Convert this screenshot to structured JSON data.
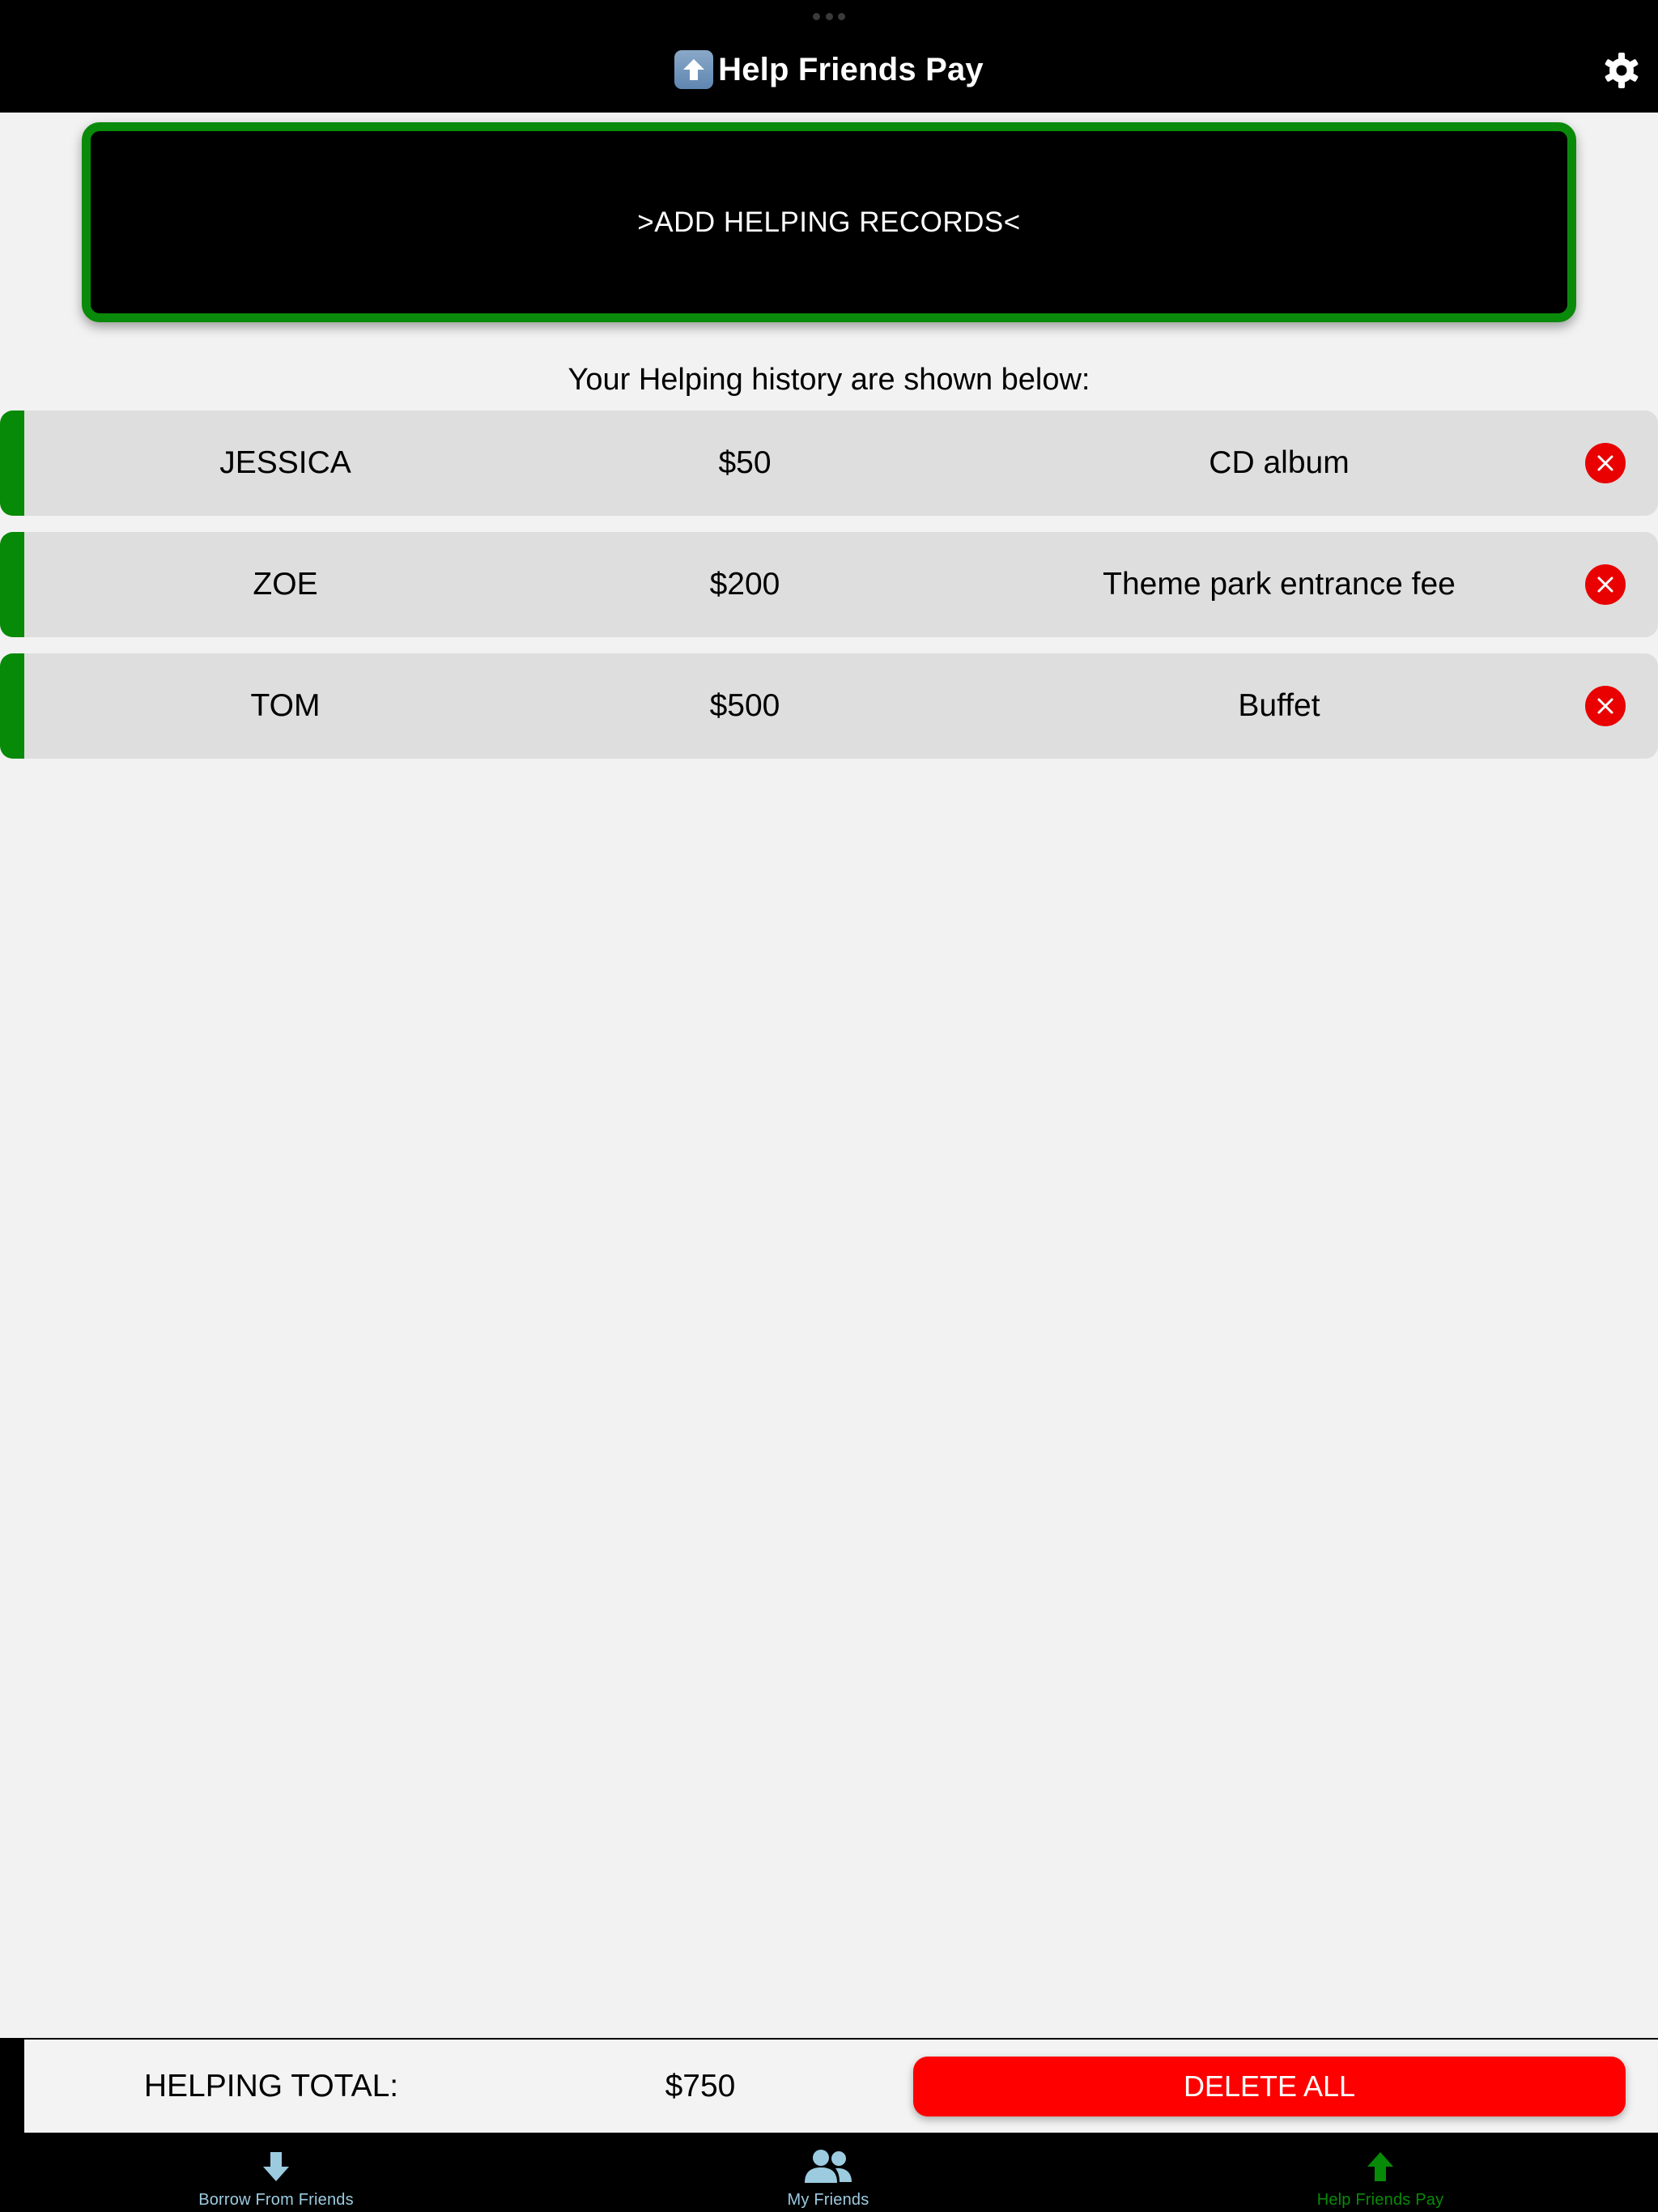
{
  "header": {
    "title": "Help Friends Pay",
    "title_icon": "up-arrow-emoji-icon",
    "settings_icon": "gear-icon"
  },
  "add_button": {
    "label": ">ADD HELPING RECORDS<"
  },
  "history_heading": "Your Helping history are shown below:",
  "records": [
    {
      "name": "JESSICA",
      "amount": "$50",
      "item": "CD album"
    },
    {
      "name": "ZOE",
      "amount": "$200",
      "item": "Theme park entrance fee"
    },
    {
      "name": "TOM",
      "amount": "$500",
      "item": "Buffet"
    }
  ],
  "footer": {
    "total_label": "HELPING TOTAL:",
    "total_value": "$750",
    "delete_all_label": "DELETE ALL"
  },
  "tabs": [
    {
      "label": "Borrow From Friends",
      "icon": "down-arrow-icon",
      "active": false
    },
    {
      "label": "My Friends",
      "icon": "people-icon",
      "active": false
    },
    {
      "label": "Help Friends Pay",
      "icon": "up-arrow-icon",
      "active": true
    }
  ],
  "colors": {
    "accent_green": "#078a07",
    "delete_red": "#ff0000",
    "inactive_tab": "#9ccbe0",
    "active_tab": "#078a07"
  }
}
